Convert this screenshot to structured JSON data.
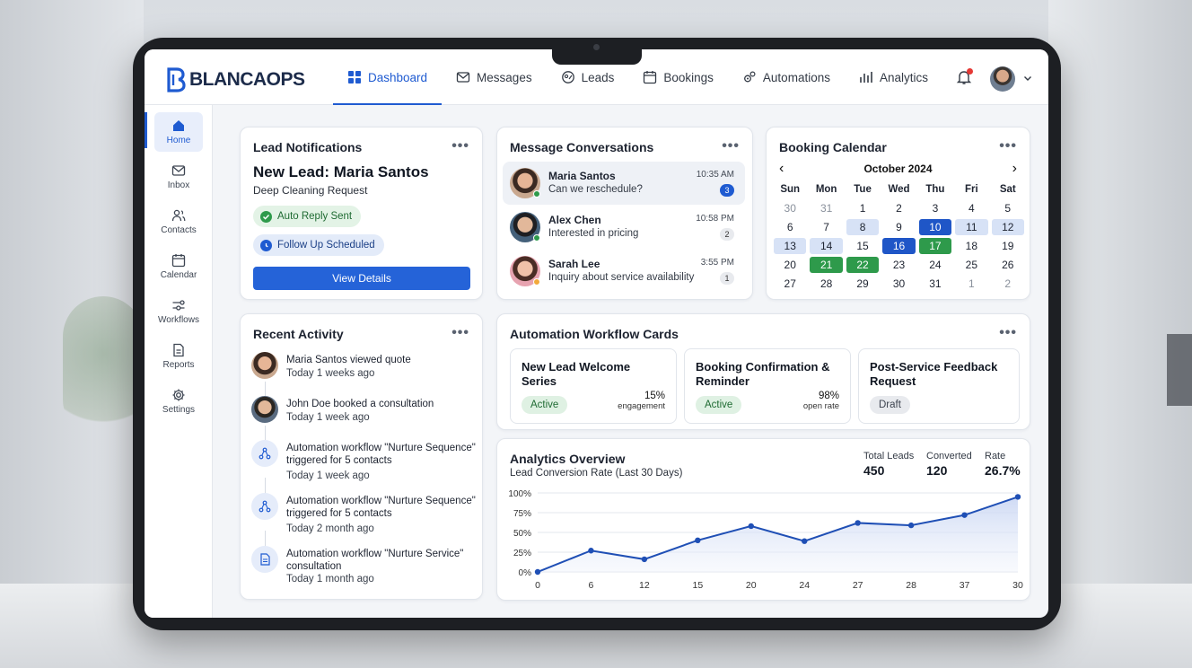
{
  "brand": {
    "name": "BLANCAOPS",
    "color": "#1f5bd1"
  },
  "nav": {
    "items": [
      {
        "label": "Dashboard",
        "icon": "grid-icon",
        "active": true
      },
      {
        "label": "Messages",
        "icon": "mail-icon",
        "active": false
      },
      {
        "label": "Leads",
        "icon": "leads-icon",
        "active": false
      },
      {
        "label": "Bookings",
        "icon": "calendar-icon",
        "active": false
      },
      {
        "label": "Automations",
        "icon": "gears-icon",
        "active": false
      },
      {
        "label": "Analytics",
        "icon": "bar-chart-icon",
        "active": false
      }
    ]
  },
  "sidebar": {
    "items": [
      {
        "label": "Home",
        "icon": "home-icon",
        "active": true
      },
      {
        "label": "Inbox",
        "icon": "inbox-icon"
      },
      {
        "label": "Contacts",
        "icon": "contacts-icon"
      },
      {
        "label": "Calendar",
        "icon": "calendar-icon"
      },
      {
        "label": "Workflows",
        "icon": "workflow-icon"
      },
      {
        "label": "Reports",
        "icon": "report-icon"
      },
      {
        "label": "Settings",
        "icon": "gear-icon"
      }
    ]
  },
  "lead_notifications": {
    "title": "Lead Notifications",
    "menu": "•••",
    "lead_name": "New Lead: Maria Santos",
    "request": "Deep Cleaning Request",
    "status_1": "Auto Reply Sent",
    "status_2": "Follow Up Scheduled",
    "button": "View Details"
  },
  "messages": {
    "title": "Message Conversations",
    "menu": "•••",
    "items": [
      {
        "name": "Maria Santos",
        "text": "Can we reschedule?",
        "time": "10:35 AM",
        "badge": "3"
      },
      {
        "name": "Alex Chen",
        "text": "Interested in pricing",
        "time": "10:58 PM",
        "badge": "2"
      },
      {
        "name": "Sarah Lee",
        "text": "Inquiry about service availability",
        "time": "3:55 PM",
        "badge": "1"
      }
    ]
  },
  "calendar": {
    "title": "Booking Calendar",
    "menu": "•••",
    "month": "October 2024",
    "prev": "‹",
    "next": "›",
    "weekdays": [
      "Sun",
      "Mon",
      "Tue",
      "Wed",
      "Thu",
      "Fri",
      "Sat"
    ],
    "days": [
      [
        "30",
        "31",
        "1",
        "2",
        "3",
        "4",
        "5"
      ],
      [
        "6",
        "7",
        "8",
        "9",
        "10",
        "11",
        "12"
      ],
      [
        "13",
        "14",
        "15",
        "16",
        "17",
        "18",
        "19"
      ],
      [
        "20",
        "21",
        "22",
        "23",
        "24",
        "25",
        "26"
      ],
      [
        "27",
        "28",
        "29",
        "30",
        "31",
        "1",
        "2"
      ]
    ]
  },
  "activity": {
    "title": "Recent Activity",
    "menu": "•••",
    "items": [
      {
        "l1": "Maria Santos viewed quote",
        "l2": "Today 1 weeks ago"
      },
      {
        "l1": "John Doe booked a consultation",
        "l2": "Today 1 week ago"
      },
      {
        "l1": "Automation workflow \"Nurture Sequence\" triggered for 5 contacts",
        "l2": "Today 1 week ago"
      },
      {
        "l1": "Automation workflow \"Nurture Sequence\" triggered for 5 contacts",
        "l2": "Today 2 month ago"
      },
      {
        "l1": "Automation workflow \"Nurture Service\" consultation",
        "l2": "Today 1 month ago"
      }
    ]
  },
  "workflows": {
    "title": "Automation Workflow Cards",
    "menu": "•••",
    "cards": [
      {
        "title": "New Lead Welcome Series",
        "status": "Active",
        "value": "15%",
        "label": "engagement"
      },
      {
        "title": "Booking Confirmation & Reminder",
        "status": "Active",
        "value": "98%",
        "label": "open rate"
      },
      {
        "title": "Post-Service Feedback Request",
        "status": "Draft",
        "value": "",
        "label": ""
      }
    ]
  },
  "analytics": {
    "title": "Analytics Overview",
    "subtitle": "Lead Conversion Rate (Last 30 Days)",
    "kpis": [
      {
        "label": "Total Leads",
        "value": "450"
      },
      {
        "label": "Converted",
        "value": "120"
      },
      {
        "label": "Rate",
        "value": "26.7%"
      }
    ]
  },
  "chart_data": {
    "type": "line",
    "x": [
      0,
      6,
      12,
      15,
      20,
      24,
      27,
      28,
      37,
      30
    ],
    "values": [
      0,
      27,
      16,
      40,
      58,
      39,
      62,
      59,
      72,
      95
    ],
    "x_ticks": [
      "0",
      "6",
      "12",
      "15",
      "20",
      "24",
      "27",
      "28",
      "37",
      "30"
    ],
    "y_ticks": [
      "0%",
      "25%",
      "50%",
      "75%",
      "100%"
    ],
    "ylim": [
      0,
      100
    ],
    "title": "Lead Conversion Rate (Last 30 Days)",
    "xlabel": "",
    "ylabel": "",
    "grid": true,
    "color": "#1f4fb5"
  }
}
